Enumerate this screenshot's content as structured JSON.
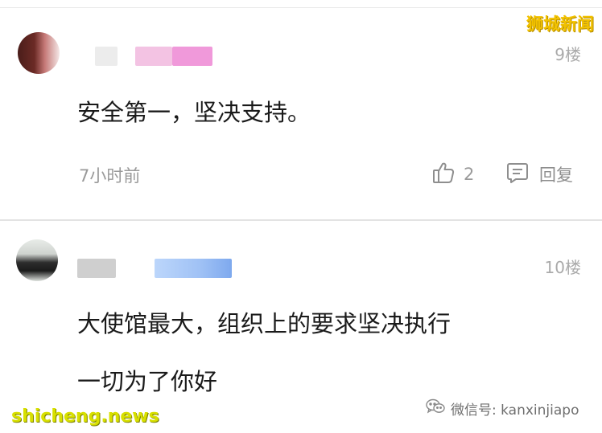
{
  "watermarks": {
    "top": "狮城新闻",
    "bottom": "shicheng.news"
  },
  "comments": [
    {
      "floor": "9楼",
      "text": "安全第一，坚决支持。",
      "time": "7小时前",
      "likes": "2",
      "reply_label": "回复"
    },
    {
      "floor": "10楼",
      "lines": [
        "大使馆最大，组织上的要求坚决执行",
        "一切为了你好"
      ]
    }
  ],
  "wechat": {
    "label": "微信号: kanxinjiapo"
  },
  "colors": {
    "watermark_top": "#f2c200",
    "watermark_bottom": "#d8e000",
    "meta_text": "#9a9a9a"
  },
  "icons": [
    "thumbs-up-icon",
    "reply-comment-icon",
    "wechat-icon"
  ]
}
